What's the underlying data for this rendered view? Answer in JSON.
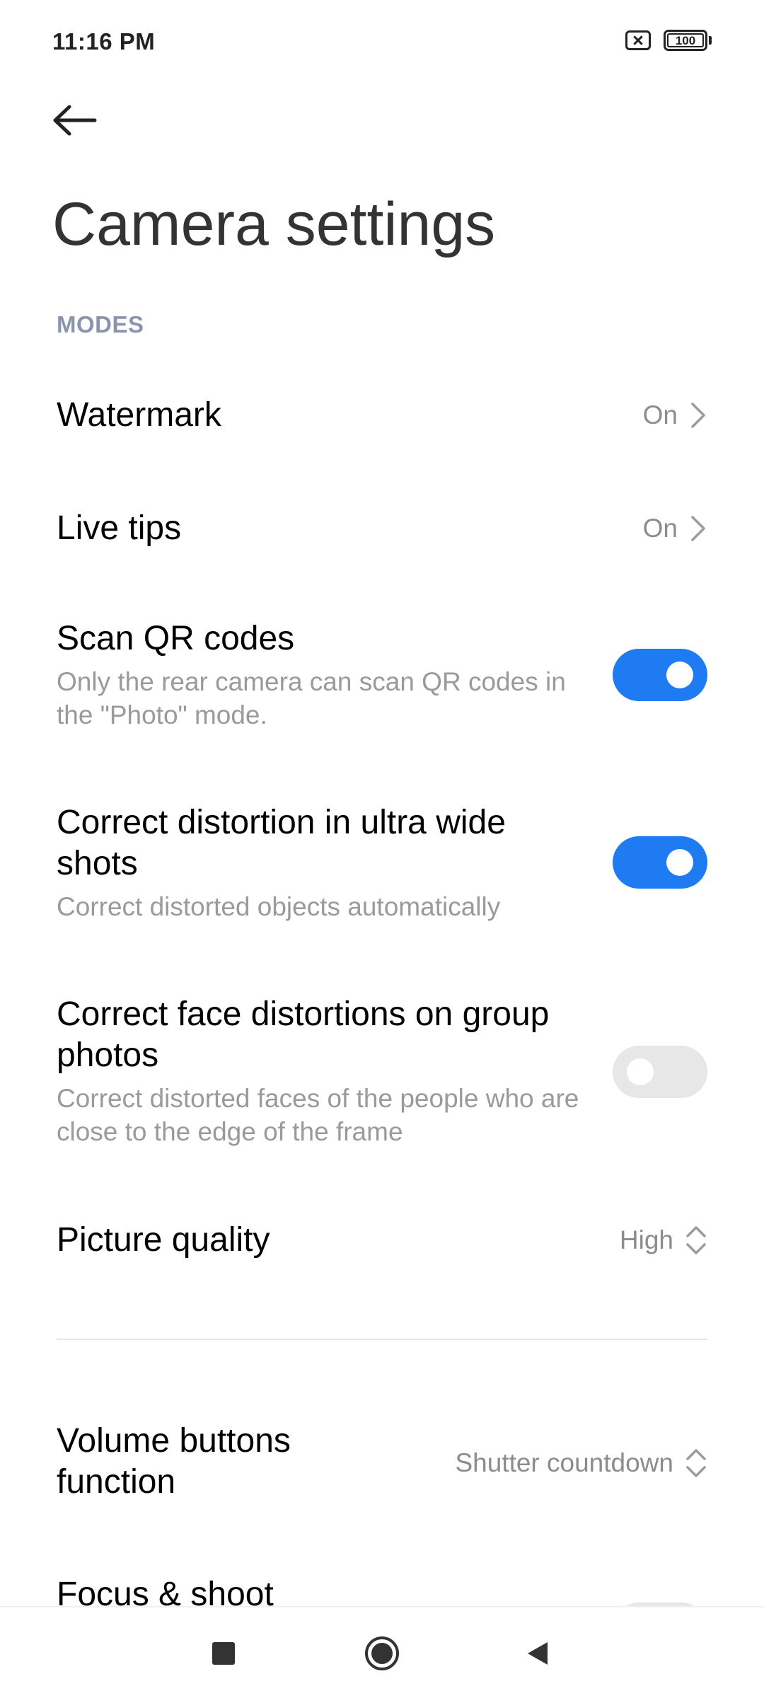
{
  "status_bar": {
    "time": "11:16 PM",
    "battery_level": "100",
    "sim_icon": "no-sim-icon",
    "battery_icon": "battery-icon"
  },
  "header": {
    "back_icon": "arrow-left-icon",
    "title": "Camera settings"
  },
  "section": {
    "label": "MODES"
  },
  "settings": {
    "watermark": {
      "title": "Watermark",
      "value": "On"
    },
    "live_tips": {
      "title": "Live tips",
      "value": "On"
    },
    "scan_qr": {
      "title": "Scan QR codes",
      "subtitle": "Only the rear camera can scan QR codes in the \"Photo\" mode.",
      "enabled": true
    },
    "correct_distortion": {
      "title": "Correct distortion in ultra wide shots",
      "subtitle": "Correct distorted objects automatically",
      "enabled": true
    },
    "face_distortion": {
      "title": "Correct face distortions on group photos",
      "subtitle": "Correct distorted faces of the people who are close to the edge of the frame",
      "enabled": false
    },
    "picture_quality": {
      "title": "Picture quality",
      "value": "High"
    },
    "volume_buttons": {
      "title": "Volume buttons function",
      "value": "Shutter countdown"
    },
    "focus_shoot": {
      "title": "Focus & shoot"
    }
  },
  "colors": {
    "accent": "#1e7bf2",
    "section_label": "#8a94ad",
    "toggle_off": "#e7e7e7"
  },
  "nav": {
    "recents_icon": "square-icon",
    "home_icon": "circle-home-icon",
    "back_icon": "triangle-back-icon"
  }
}
